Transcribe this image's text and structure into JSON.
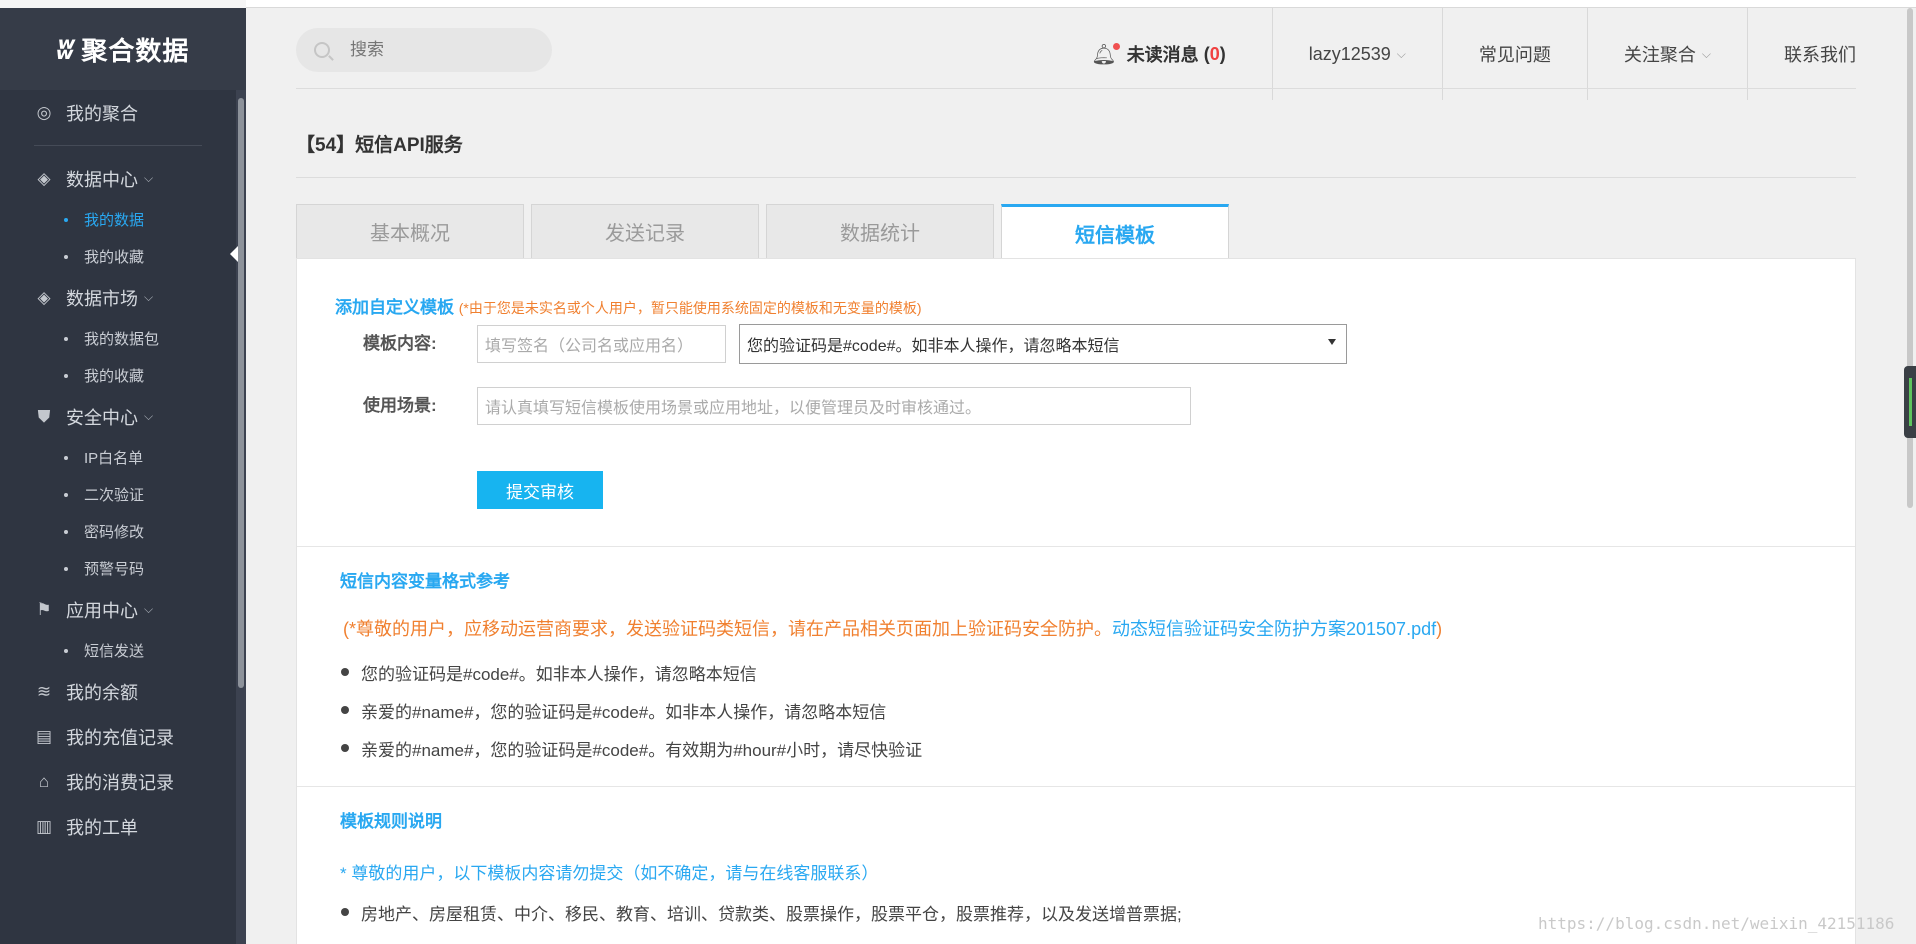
{
  "app": {
    "logo_text": "聚合数据"
  },
  "sidebar": {
    "items": [
      {
        "label": "我的聚合",
        "icon": "user-circle-icon",
        "sub": []
      },
      {
        "label": "数据中心",
        "icon": "layers-icon",
        "sub": [
          {
            "label": "我的数据",
            "active": true
          },
          {
            "label": "我的收藏"
          }
        ]
      },
      {
        "label": "数据市场",
        "icon": "layers-icon",
        "sub": [
          {
            "label": "我的数据包"
          },
          {
            "label": "我的收藏"
          }
        ]
      },
      {
        "label": "安全中心",
        "icon": "shield-icon",
        "sub": [
          {
            "label": "IP白名单"
          },
          {
            "label": "二次验证"
          },
          {
            "label": "密码修改"
          },
          {
            "label": "预警号码"
          }
        ]
      },
      {
        "label": "应用中心",
        "icon": "flag-icon",
        "sub": [
          {
            "label": "短信发送"
          }
        ]
      },
      {
        "label": "我的余额",
        "icon": "database-icon",
        "sub": []
      },
      {
        "label": "我的充值记录",
        "icon": "card-icon",
        "sub": []
      },
      {
        "label": "我的消费记录",
        "icon": "basket-icon",
        "sub": []
      },
      {
        "label": "我的工单",
        "icon": "clipboard-icon",
        "sub": []
      }
    ]
  },
  "header": {
    "search_placeholder": "搜索",
    "messages_label": "未读消息",
    "messages_count": "0",
    "user_name": "lazy12539",
    "faq": "常见问题",
    "follow": "关注聚合",
    "contact": "联系我们"
  },
  "page": {
    "title": "【54】短信API服务",
    "tabs": [
      "基本概况",
      "发送记录",
      "数据统计",
      "短信模板"
    ],
    "active_tab": "短信模板"
  },
  "custom_template": {
    "title": "添加自定义模板",
    "note": "(*由于您是未实名或个人用户，暂只能使用系统固定的模板和无变量的模板)",
    "content_label": "模板内容:",
    "signature_placeholder": "填写签名（公司名或应用名）",
    "template_selected": "您的验证码是#code#。如非本人操作，请忽略本短信",
    "scene_label": "使用场景:",
    "scene_placeholder": "请认真填写短信模板使用场景或应用地址，以便管理员及时审核通过。",
    "submit": "提交审核"
  },
  "variable_reference": {
    "title": "短信内容变量格式参考",
    "note_prefix": "(*尊敬的用户，应移动运营商要求，发送验证码类短信，请在产品相关页面加上验证码安全防护。",
    "note_link": "动态短信验证码安全防护方案201507.pdf",
    "note_suffix": ")",
    "examples": [
      "您的验证码是#code#。如非本人操作，请忽略本短信",
      "亲爱的#name#，您的验证码是#code#。如非本人操作，请忽略本短信",
      "亲爱的#name#，您的验证码是#code#。有效期为#hour#小时，请尽快验证"
    ]
  },
  "rules": {
    "title": "模板规则说明",
    "note": "* 尊敬的用户，以下模板内容请勿提交（如不确定，请与在线客服联系）",
    "items": [
      "房地产、房屋租赁、中介、移民、教育、培训、贷款类、股票操作，股票平仓，股票推荐，以及发送增普票据;"
    ]
  },
  "watermark": "https://blog.csdn.net/weixin_42151186"
}
